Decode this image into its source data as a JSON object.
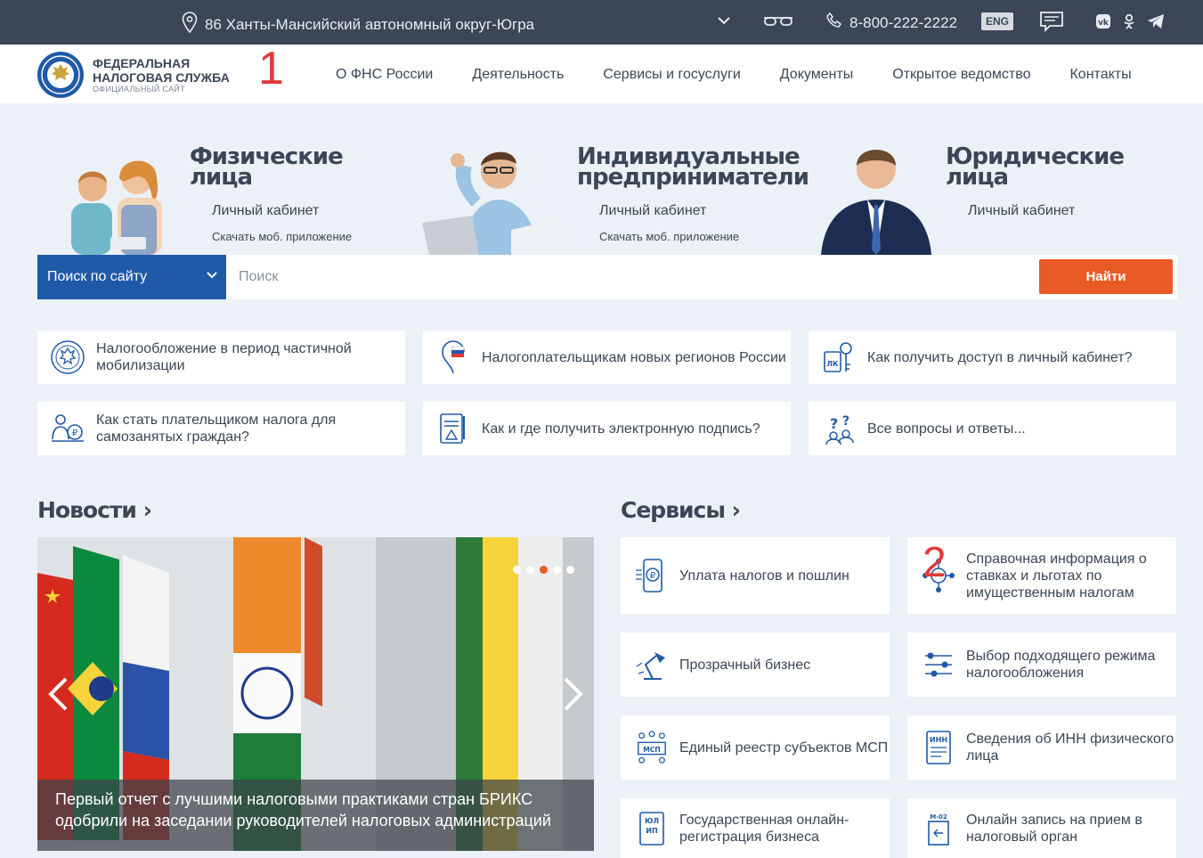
{
  "topbar": {
    "region": "86 Ханты-Мансийский автономный округ-Югра",
    "phone": "8-800-222-2222",
    "lang": "ENG"
  },
  "logo": {
    "line1": "ФЕДЕРАЛЬНАЯ",
    "line2": "НАЛОГОВАЯ СЛУЖБА",
    "line3": "ОФИЦИАЛЬНЫЙ САЙТ"
  },
  "marks": {
    "one": "1",
    "two": "2"
  },
  "nav": [
    "О ФНС России",
    "Деятельность",
    "Сервисы и госуслуги",
    "Документы",
    "Открытое ведомство",
    "Контакты"
  ],
  "personas": [
    {
      "title1": "Физические",
      "title2": "лица",
      "cabinet": "Личный кабинет",
      "app": "Скачать моб. приложение"
    },
    {
      "title1": "Индивидуальные",
      "title2": "предприниматели",
      "cabinet": "Личный кабинет",
      "app": "Скачать моб. приложение"
    },
    {
      "title1": "Юридические",
      "title2": "лица",
      "cabinet": "Личный кабинет",
      "app": ""
    }
  ],
  "search": {
    "scope": "Поиск по сайту",
    "placeholder": "Поиск",
    "button": "Найти"
  },
  "quick_links": [
    "Налогообложение в период частичной мобилизации",
    "Налогоплательщикам новых регионов России",
    "Как получить доступ в личный кабинет?",
    "Как стать плательщиком налога для самозанятых граждан?",
    "Как и где получить электронную подпись?",
    "Все вопросы и ответы..."
  ],
  "news": {
    "title": "Новости",
    "caption": "Первый отчет с лучшими налоговыми практиками стран БРИКС одобрили на заседании руководителей налоговых администраций",
    "slides": 5,
    "active_slide": 3
  },
  "services": {
    "title": "Сервисы",
    "items": [
      "Уплата налогов и пошлин",
      "Справочная информация о ставках и льготах по имущественным налогам",
      "Прозрачный бизнес",
      "Выбор подходящего режима налогообложения",
      "Единый реестр субъектов МСП",
      "Сведения об ИНН физического лица",
      "Государственная онлайн-регистрация бизнеса",
      "Онлайн запись на прием в налоговый орган"
    ]
  },
  "colors": {
    "topbar": "#3b4656",
    "accent": "#1f5aa8",
    "button": "#ea5a24",
    "background": "#ecf1f7"
  }
}
